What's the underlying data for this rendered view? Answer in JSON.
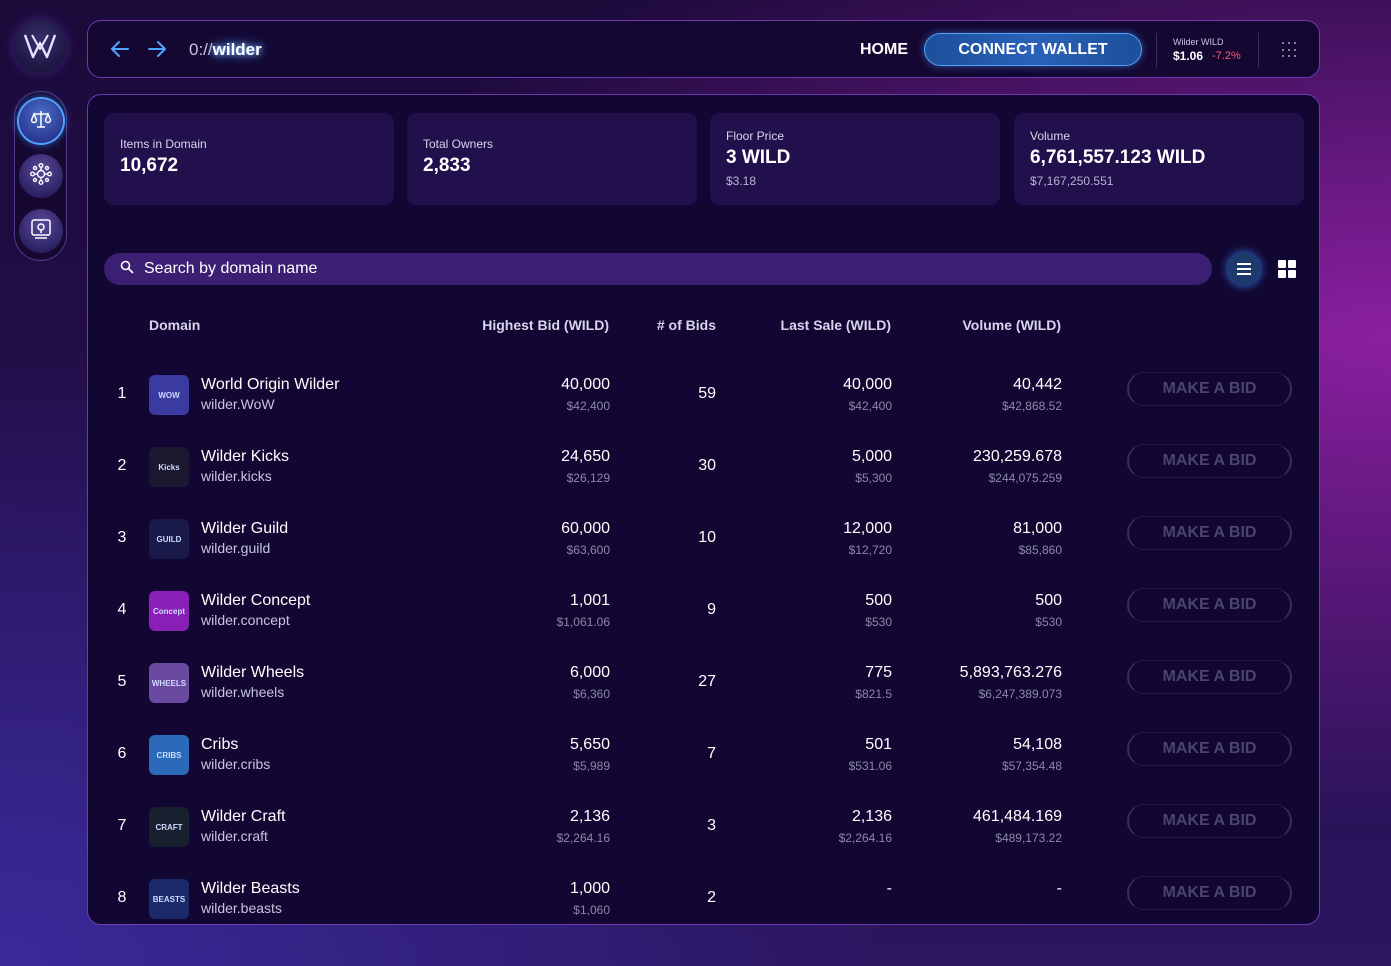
{
  "nav": {
    "url_prefix": "0://",
    "url_domain": "wilder",
    "home_label": "HOME",
    "connect_label": "CONNECT WALLET",
    "token_label": "Wilder WILD",
    "token_price": "$1.06",
    "token_change": "-7.2%",
    "change_color": "#ff5a7a",
    "accent_color": "#4fa3ff"
  },
  "stats": [
    {
      "label": "Items in Domain",
      "value": "10,672",
      "sub": ""
    },
    {
      "label": "Total Owners",
      "value": "2,833",
      "sub": ""
    },
    {
      "label": "Floor Price",
      "value": "3 WILD",
      "sub": "$3.18"
    },
    {
      "label": "Volume",
      "value": "6,761,557.123 WILD",
      "sub": "$7,167,250.551"
    }
  ],
  "search": {
    "placeholder": "Search by domain name"
  },
  "table": {
    "headers": {
      "domain": "Domain",
      "highest_bid": "Highest Bid (WILD)",
      "num_bids": "# of Bids",
      "last_sale": "Last Sale (WILD)",
      "volume": "Volume (WILD)"
    },
    "bid_label": "MAKE A BID",
    "rows": [
      {
        "index": "1",
        "name": "World Origin Wilder",
        "domain": "wilder.WoW",
        "thumb_text": "WOW",
        "thumb_color": "#3a3aa0",
        "highest_bid": "40,000",
        "highest_bid_usd": "$42,400",
        "bids": "59",
        "last_sale": "40,000",
        "last_sale_usd": "$42,400",
        "volume": "40,442",
        "volume_usd": "$42,868.52"
      },
      {
        "index": "2",
        "name": "Wilder Kicks",
        "domain": "wilder.kicks",
        "thumb_text": "Kicks",
        "thumb_color": "#1c1830",
        "highest_bid": "24,650",
        "highest_bid_usd": "$26,129",
        "bids": "30",
        "last_sale": "5,000",
        "last_sale_usd": "$5,300",
        "volume": "230,259.678",
        "volume_usd": "$244,075.259"
      },
      {
        "index": "3",
        "name": "Wilder Guild",
        "domain": "wilder.guild",
        "thumb_text": "GUILD",
        "thumb_color": "#1a1a4a",
        "highest_bid": "60,000",
        "highest_bid_usd": "$63,600",
        "bids": "10",
        "last_sale": "12,000",
        "last_sale_usd": "$12,720",
        "volume": "81,000",
        "volume_usd": "$85,860"
      },
      {
        "index": "4",
        "name": "Wilder Concept",
        "domain": "wilder.concept",
        "thumb_text": "Concept",
        "thumb_color": "#8a1fb8",
        "highest_bid": "1,001",
        "highest_bid_usd": "$1,061.06",
        "bids": "9",
        "last_sale": "500",
        "last_sale_usd": "$530",
        "volume": "500",
        "volume_usd": "$530"
      },
      {
        "index": "5",
        "name": "Wilder Wheels",
        "domain": "wilder.wheels",
        "thumb_text": "WHEELS",
        "thumb_color": "#6a4aa0",
        "highest_bid": "6,000",
        "highest_bid_usd": "$6,360",
        "bids": "27",
        "last_sale": "775",
        "last_sale_usd": "$821.5",
        "volume": "5,893,763.276",
        "volume_usd": "$6,247,389.073"
      },
      {
        "index": "6",
        "name": "Cribs",
        "domain": "wilder.cribs",
        "thumb_text": "CRIBS",
        "thumb_color": "#2a6ab8",
        "highest_bid": "5,650",
        "highest_bid_usd": "$5,989",
        "bids": "7",
        "last_sale": "501",
        "last_sale_usd": "$531.06",
        "volume": "54,108",
        "volume_usd": "$57,354.48"
      },
      {
        "index": "7",
        "name": "Wilder Craft",
        "domain": "wilder.craft",
        "thumb_text": "CRAFT",
        "thumb_color": "#182030",
        "highest_bid": "2,136",
        "highest_bid_usd": "$2,264.16",
        "bids": "3",
        "last_sale": "2,136",
        "last_sale_usd": "$2,264.16",
        "volume": "461,484.169",
        "volume_usd": "$489,173.22"
      },
      {
        "index": "8",
        "name": "Wilder Beasts",
        "domain": "wilder.beasts",
        "thumb_text": "BEASTS",
        "thumb_color": "#1a2a6a",
        "highest_bid": "1,000",
        "highest_bid_usd": "$1,060",
        "bids": "2",
        "last_sale": "-",
        "last_sale_usd": "",
        "volume": "-",
        "volume_usd": ""
      }
    ]
  },
  "icons": {
    "logo": "wilder-logo-icon",
    "nav_items": [
      "scales-icon",
      "network-icon",
      "safe-icon"
    ],
    "view_list": "list-view-icon",
    "view_grid": "grid-view-icon",
    "search": "search-icon"
  }
}
